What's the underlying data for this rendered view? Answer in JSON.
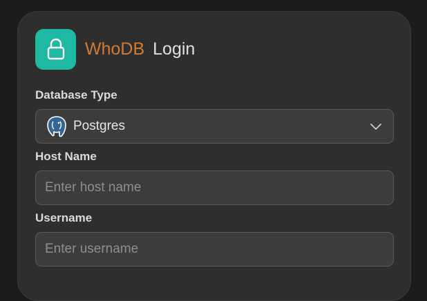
{
  "header": {
    "brand": "WhoDB",
    "title": "Login",
    "icon": "lock-icon",
    "accent_color": "#1fb8a2",
    "brand_color": "#d27a32"
  },
  "form": {
    "database_type": {
      "label": "Database Type",
      "value": "Postgres",
      "icon": "postgres-elephant-icon"
    },
    "host_name": {
      "label": "Host Name",
      "value": "",
      "placeholder": "Enter host name"
    },
    "username": {
      "label": "Username",
      "value": "",
      "placeholder": "Enter username"
    }
  }
}
